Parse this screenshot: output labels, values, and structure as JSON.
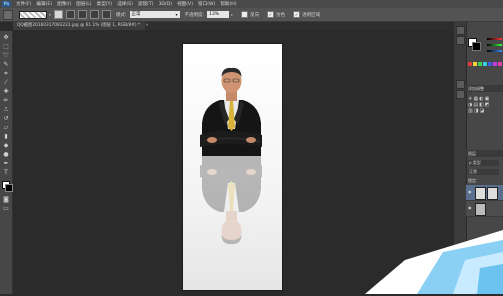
{
  "app": {
    "logo": "Ps"
  },
  "menu": [
    "文件(F)",
    "编辑(E)",
    "图像(I)",
    "图层(L)",
    "类型(Y)",
    "选择(S)",
    "滤镜(T)",
    "3D(D)",
    "视图(V)",
    "窗口(W)",
    "帮助(H)"
  ],
  "options": {
    "mode_label": "模式:",
    "mode_value": "正常",
    "opacity_label": "不透明度:",
    "opacity_value": "13%",
    "reverse_label": "反向",
    "dither_label": "仿色",
    "transparency_label": "透明区域"
  },
  "document": {
    "tab_title": "QQ截图20160317082222.jpg @ 61.1% (图层 1, RGB/8#) *"
  },
  "panels": {
    "adjust_tab": "添加调整",
    "layers_tab": "图层",
    "layers_kind": "ρ 类型",
    "layers_mode": "正常",
    "lock_label": "锁定:"
  },
  "colors": {
    "foreground": "#ffffff",
    "background": "#000000",
    "app_bg": "#2b2b2b",
    "selected_layer": "#5a6f8d"
  }
}
